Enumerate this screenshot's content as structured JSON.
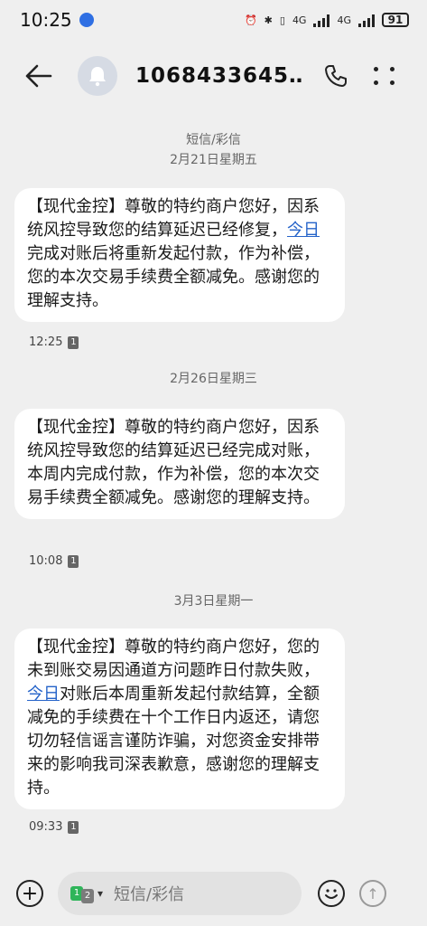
{
  "status_bar": {
    "time": "10:25",
    "network_1": "4G",
    "network_2": "4G",
    "battery": "91"
  },
  "header": {
    "contact": "1068433645…"
  },
  "conversation": {
    "type_label": "短信/彩信",
    "groups": [
      {
        "date": "2月21日星期五",
        "text_before": "【现代金控】尊敬的特约商户您好，因系统风控导致您的结算延迟已经修复，",
        "highlight": "今日",
        "text_after": "完成对账后将重新发起付款，作为补偿，您的本次交易手续费全额减免。感谢您的理解支持。",
        "time": "12:25",
        "sim": "1"
      },
      {
        "date": "2月26日星期三",
        "text": "【现代金控】尊敬的特约商户您好，因系统风控导致您的结算延迟已经完成对账，本周内完成付款，作为补偿，您的本次交易手续费全额减免。感谢您的理解支持。",
        "time": "10:08",
        "sim": "1"
      },
      {
        "date": "3月3日星期一",
        "text_before": "【现代金控】尊敬的特约商户您好，您的未到账交易因通道方问题昨日付款失败，",
        "highlight": "今日",
        "text_after": "对账后本周重新发起付款结算，全额减免的手续费在十个工作日内返还，请您切勿轻信谣言谨防诈骗，对您资金安排带来的影响我司深表歉意，感谢您的理解支持。",
        "time": "09:33",
        "sim": "1"
      }
    ]
  },
  "composer": {
    "sim_1": "1",
    "sim_2": "2",
    "placeholder": "短信/彩信"
  }
}
